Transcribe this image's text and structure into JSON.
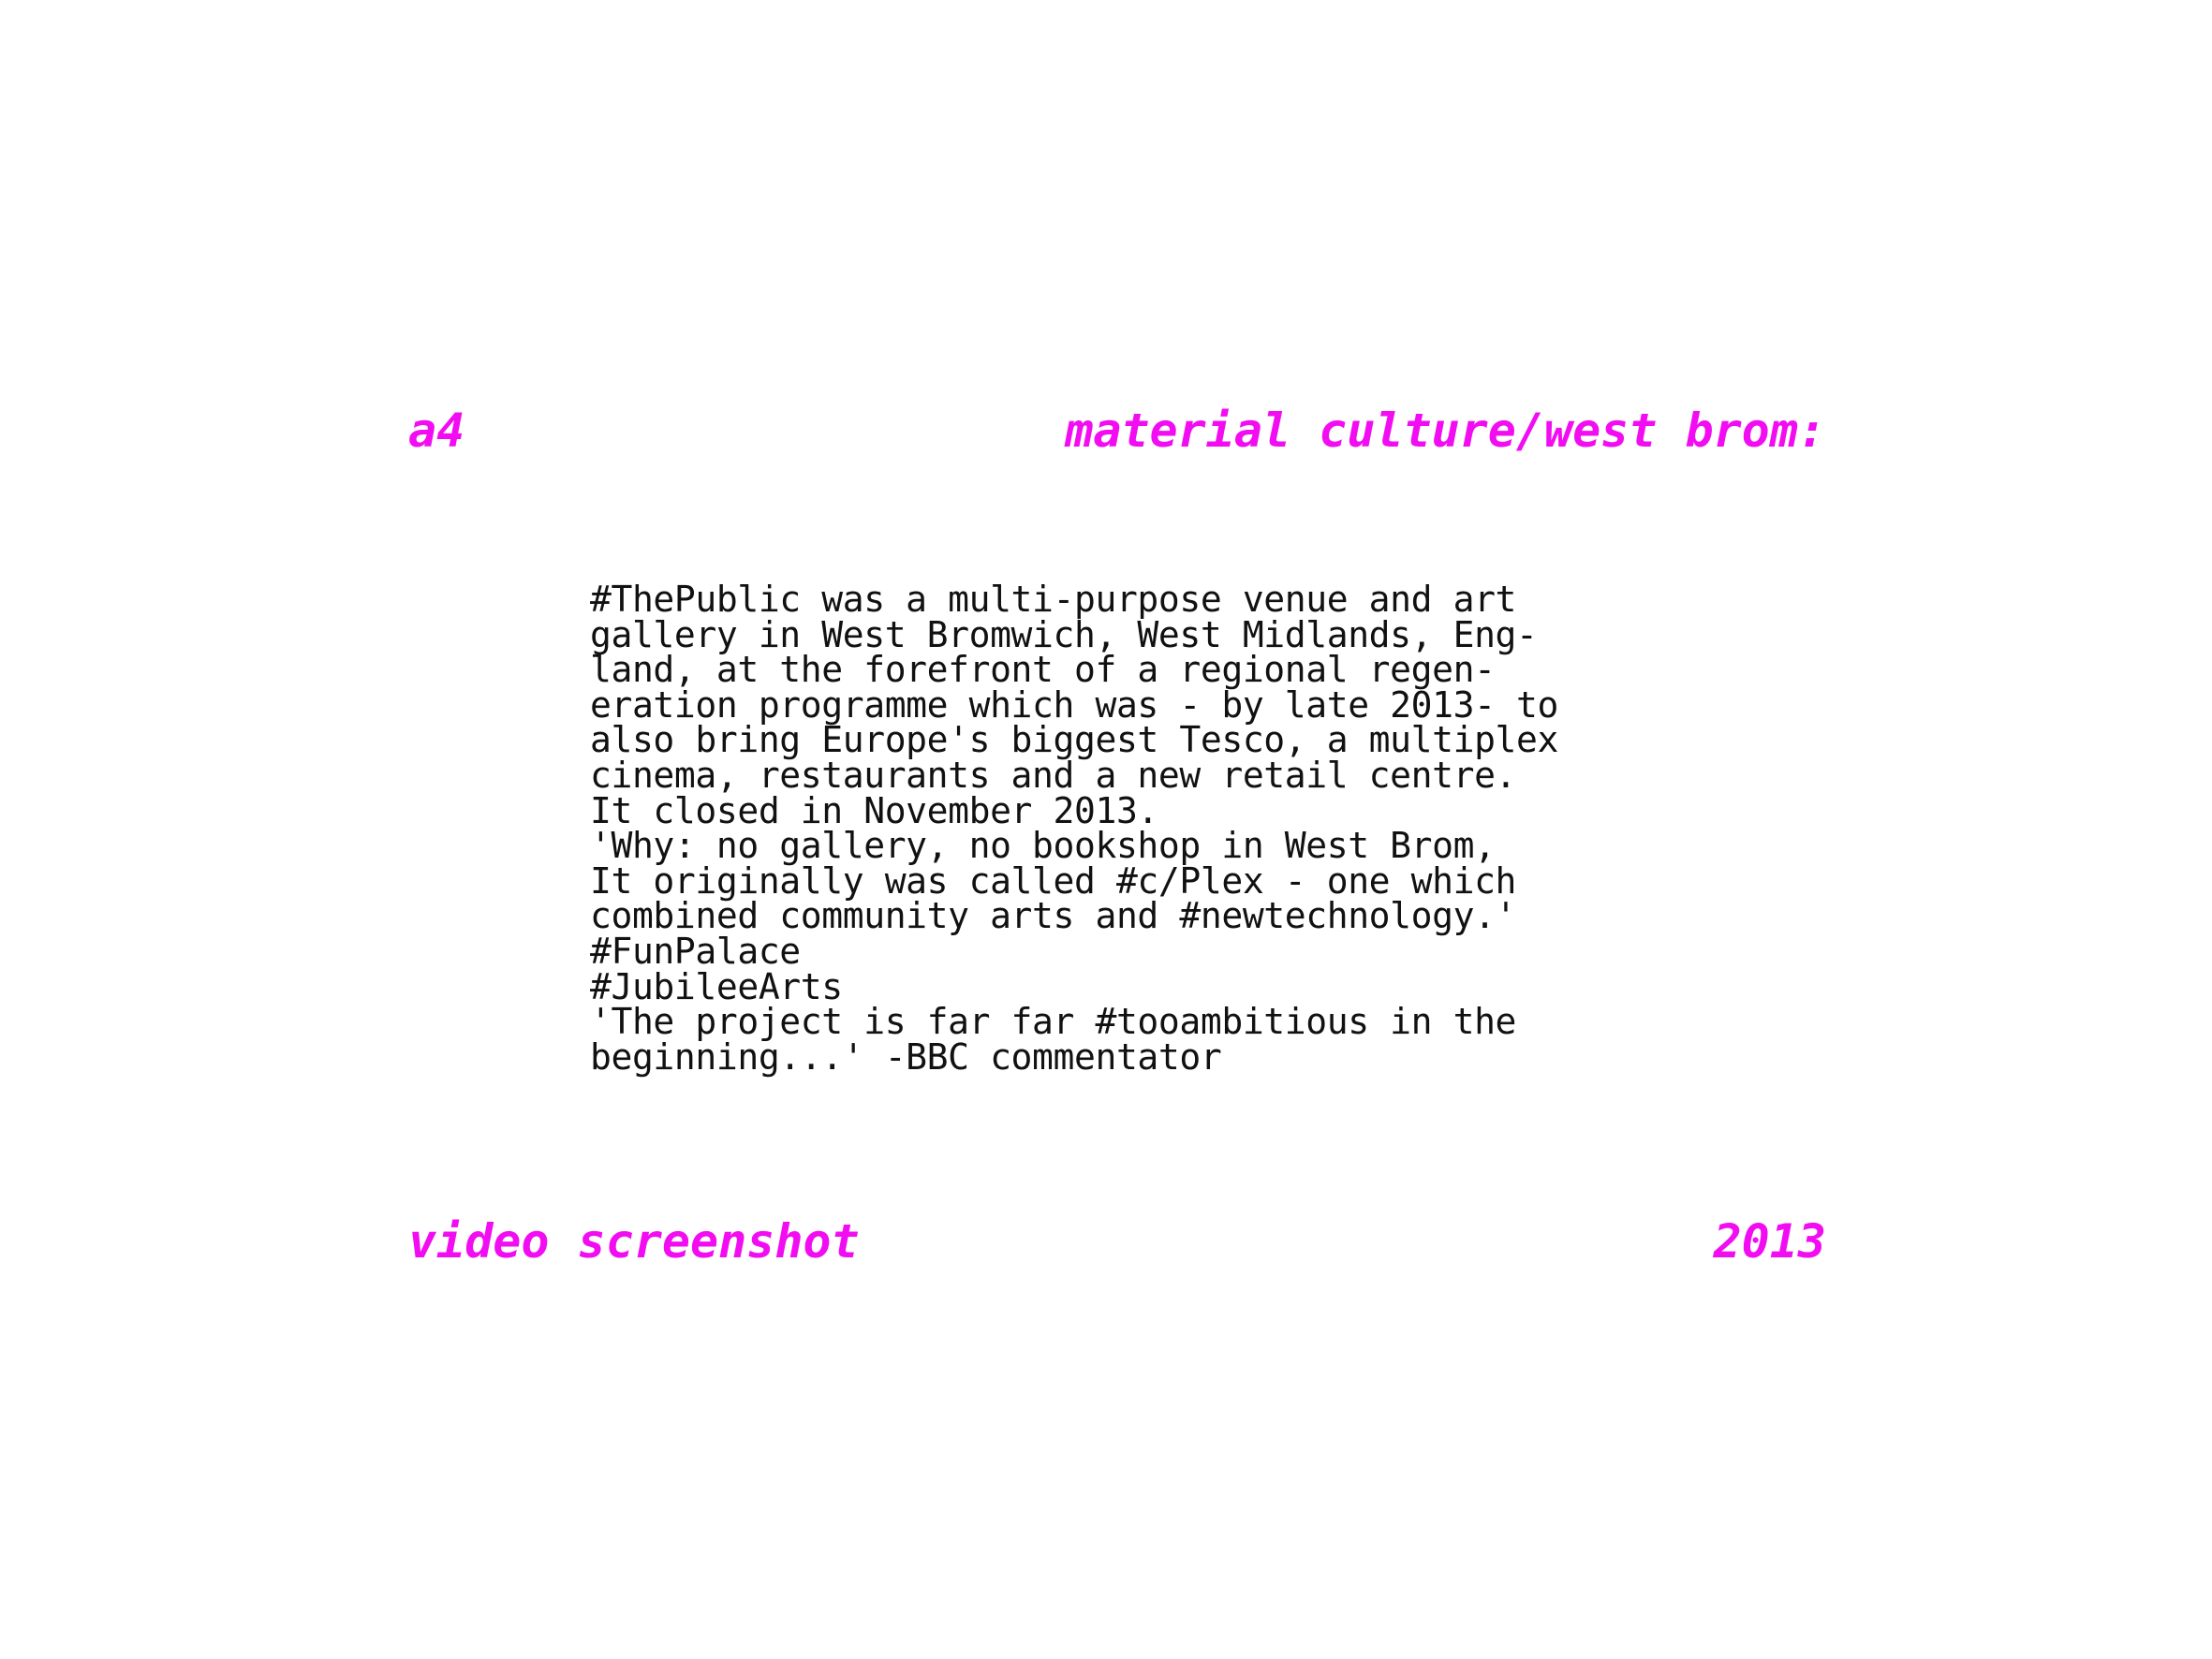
{
  "header": {
    "label_left": "a4",
    "label_right": "material culture/west brom:"
  },
  "footer": {
    "label_left": "video screenshot",
    "label_right": "2013"
  },
  "body": {
    "lines": [
      "#ThePublic was a multi-purpose venue and art",
      "gallery in West Bromwich, West Midlands, Eng-",
      "land, at the forefront of a regional regen-",
      "eration programme which was - by late 2013- to",
      "also bring Europe's biggest Tesco, a multiplex",
      "cinema, restaurants and a new retail centre.",
      "It closed in November 2013.",
      "'Why: no gallery, no bookshop in West Brom,",
      "It originally was called #c/Plex - one which",
      "combined community arts and #newtechnology.'",
      "#FunPalace",
      "#JubileeArts",
      "'The project is far far #tooambitious in the",
      "beginning...' -BBC commentator"
    ]
  },
  "colors": {
    "accent": "#f20cf2",
    "text": "#111111",
    "background": "#ffffff"
  }
}
